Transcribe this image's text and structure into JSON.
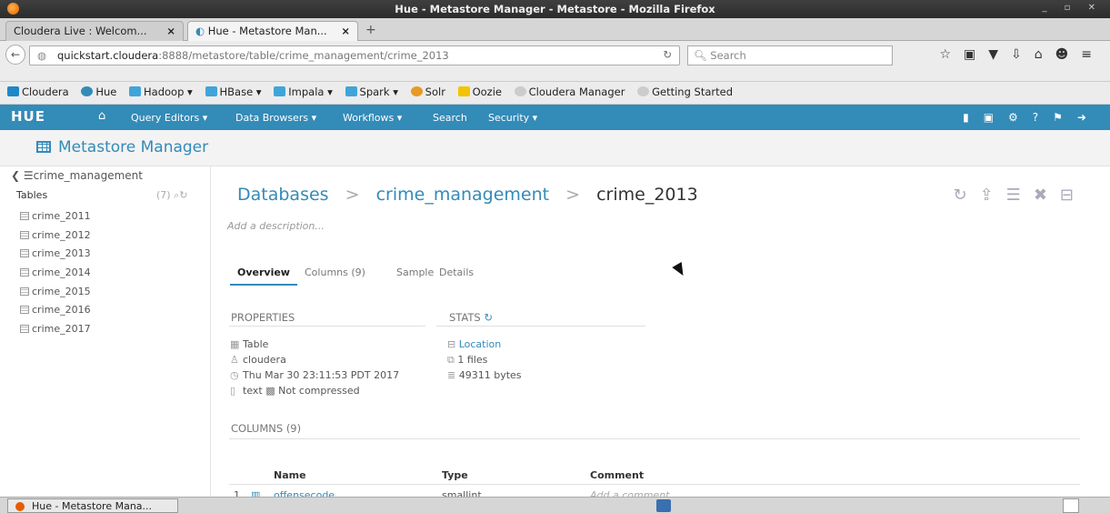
{
  "window": {
    "title": "Hue - Metastore Manager - Metastore - Mozilla Firefox"
  },
  "tabs": [
    {
      "label": "Cloudera Live : Welcom...",
      "close": "×"
    },
    {
      "label": "Hue - Metastore Man...",
      "close": "×"
    }
  ],
  "new_tab": "+",
  "nav": {
    "url_host": "quickstart.cloudera",
    "url_path": ":8888/metastore/table/crime_management/crime_2013",
    "search_placeholder": "Search",
    "back_symbol": "←"
  },
  "bookmarks": [
    "Cloudera",
    "Hue",
    "Hadoop",
    "HBase",
    "Impala",
    "Spark",
    "Solr",
    "Oozie",
    "Cloudera Manager",
    "Getting Started"
  ],
  "hue": {
    "logo": "HUE",
    "menu": [
      "Query Editors",
      "Data Browsers",
      "Workflows",
      "Search",
      "Security"
    ]
  },
  "page": {
    "title": "Metastore Manager"
  },
  "sidebar": {
    "database": "crime_management",
    "tables_label": "Tables",
    "tables_count": "(7)",
    "tables": [
      "crime_2011",
      "crime_2012",
      "crime_2013",
      "crime_2014",
      "crime_2015",
      "crime_2016",
      "crime_2017"
    ]
  },
  "breadcrumb": {
    "databases": "Databases",
    "db": "crime_management",
    "table": "crime_2013",
    "sep": ">"
  },
  "description_placeholder": "Add a description...",
  "overview_tabs": [
    "Overview",
    "Columns (9)",
    "Sample",
    "Details"
  ],
  "properties": {
    "header": "PROPERTIES",
    "type": "Table",
    "owner": "cloudera",
    "created": "Thu Mar 30 23:11:53 PDT 2017",
    "format": "text",
    "compression": "Not compressed"
  },
  "stats": {
    "header": "STATS",
    "location": "Location",
    "files": "1 files",
    "size": "49311 bytes"
  },
  "columns_section": {
    "header": "COLUMNS (9)",
    "col_name": "Name",
    "col_type": "Type",
    "col_comment": "Comment",
    "rows": [
      {
        "index": "1",
        "name": "offensecode",
        "type": "smallint",
        "comment": "Add a comment..."
      }
    ]
  },
  "taskbar": {
    "item": "Hue - Metastore Mana..."
  }
}
